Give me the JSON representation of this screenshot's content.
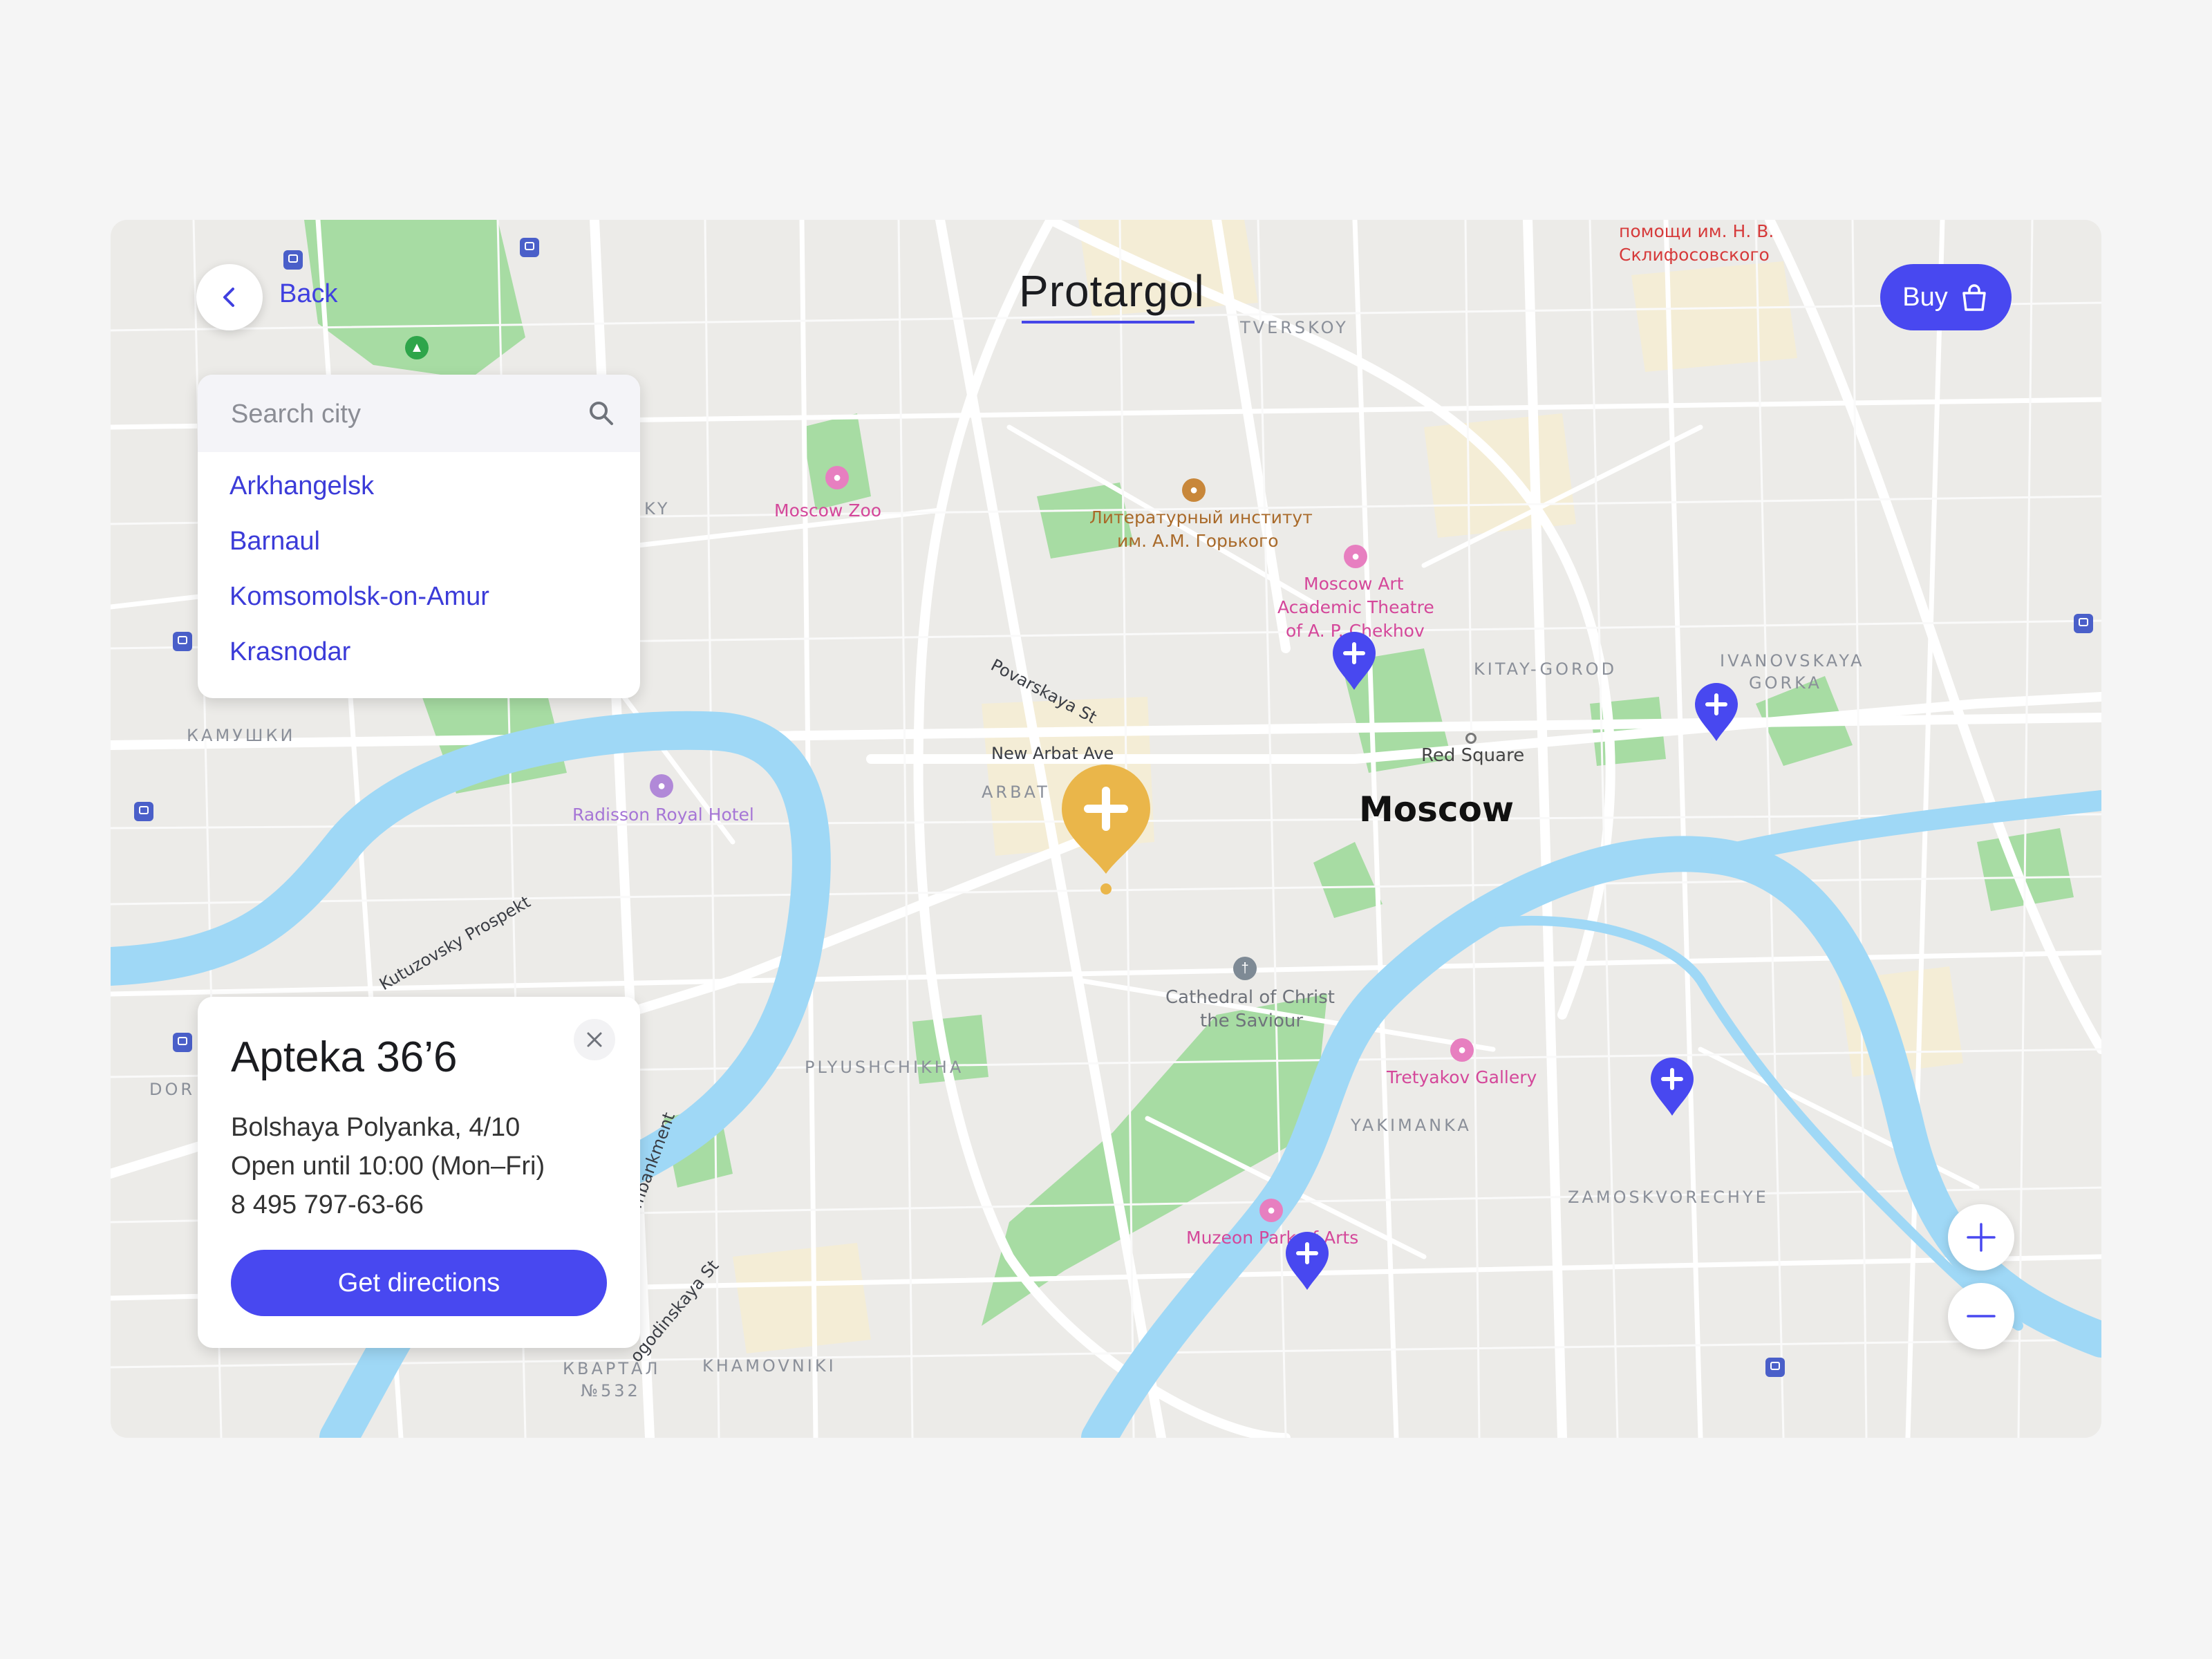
{
  "header": {
    "back_label": "Back",
    "title": "Protargol",
    "buy_label": "Buy"
  },
  "search": {
    "placeholder": "Search city",
    "cities": [
      "Arkhangelsk",
      "Barnaul",
      "Komsomolsk-on-Amur",
      "Krasnodar"
    ]
  },
  "pharmacy": {
    "name": "Apteka 36’6",
    "address": "Bolshaya Polyanka, 4/10",
    "hours": "Open until 10:00 (Mon–Fri)",
    "phone": "8 495 797-63-66",
    "directions_label": "Get directions"
  },
  "map": {
    "city_label": "Moscow",
    "districts": {
      "tverskoy": "TVERSKOY",
      "arbat": "ARBAT",
      "kitay_gorod": "KITAY-GOROD",
      "ivanovskaya_1": "IVANOVSKAYA",
      "ivanovskaya_2": "GORKA",
      "plyushchikha": "PLYUSHCHIKHA",
      "yakimanka": "YAKIMANKA",
      "zamoskvorechye": "ZAMOSKVORECHYE",
      "khamovniki": "KHAMOVNIKI",
      "kamushki": "КАМУШКИ",
      "kvartal_1": "КВАРТАЛ",
      "kvartal_2": "№532",
      "dor": "DOR",
      "ky": "KY"
    },
    "pois": {
      "zoo": "Moscow Zoo",
      "lit_institute_1": "Литературный институт",
      "lit_institute_2": "им. А.М. Горького",
      "mxat_1": "Moscow Art",
      "mxat_2": "Academic Theatre",
      "mxat_3": "of A. P. Chekhov",
      "radisson": "Radisson Royal Hotel",
      "red_square": "Red Square",
      "cathedral_1": "Cathedral of Christ",
      "cathedral_2": "the Saviour",
      "tretyakov": "Tretyakov Gallery",
      "muzeon": "Muzeon Park of Arts",
      "sklif_1": "помощи им. Н. В.",
      "sklif_2": "Склифосовского"
    },
    "streets": {
      "povarskaya": "Povarskaya St",
      "new_arbat": "New Arbat Ave",
      "kutuzovsky": "Kutuzovsky Prospekt",
      "embankment": "mbankment",
      "pogodinskaya": "ogodinskaya St"
    }
  },
  "colors": {
    "accent": "#4848f0",
    "selected_marker": "#eab64a",
    "water": "#9fd8f6",
    "park": "#9fd99b",
    "land": "#ecebe8"
  },
  "icons": {
    "back": "chevron-left-icon",
    "buy": "shopping-bag-icon",
    "search": "search-icon",
    "close": "close-icon",
    "zoom_in": "plus-icon",
    "zoom_out": "minus-icon",
    "marker": "pharmacy-marker-icon"
  }
}
